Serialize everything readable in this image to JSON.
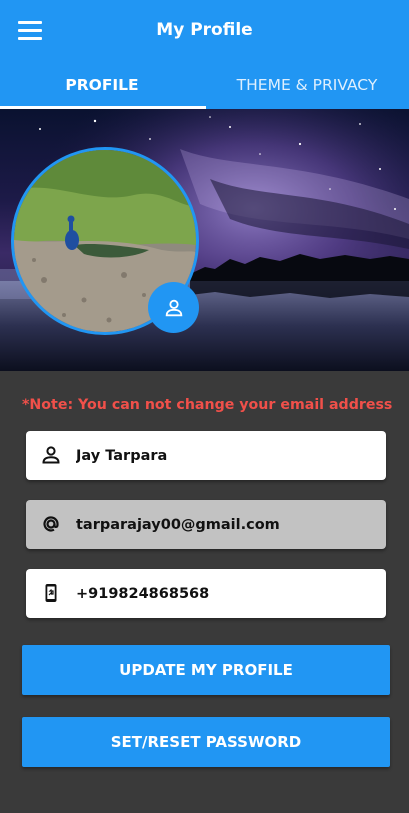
{
  "appbar": {
    "title": "My Profile",
    "menu_icon": "hamburger-menu-icon",
    "background": "#2196f3"
  },
  "tabs": [
    {
      "label": "PROFILE",
      "active": true
    },
    {
      "label": "THEME & PRIVACY",
      "active": false
    }
  ],
  "cover": {
    "image": "night sky over lake photo"
  },
  "avatar": {
    "image": "peacock photo",
    "edit_icon": "person-icon"
  },
  "note": "*Note: You can not change your email address",
  "fields": {
    "name": {
      "value": "Jay Tarpara",
      "icon": "person-icon"
    },
    "email": {
      "value": "tarparajay00@gmail.com",
      "icon": "at-sign-icon",
      "disabled": true
    },
    "phone": {
      "value": "+919824868568",
      "icon": "phone-icon"
    }
  },
  "buttons": {
    "update": "UPDATE MY PROFILE",
    "reset_password": "SET/RESET PASSWORD"
  },
  "colors": {
    "accent": "#2196f3",
    "note": "#f0504a",
    "body_bg": "#3a3a3a"
  }
}
